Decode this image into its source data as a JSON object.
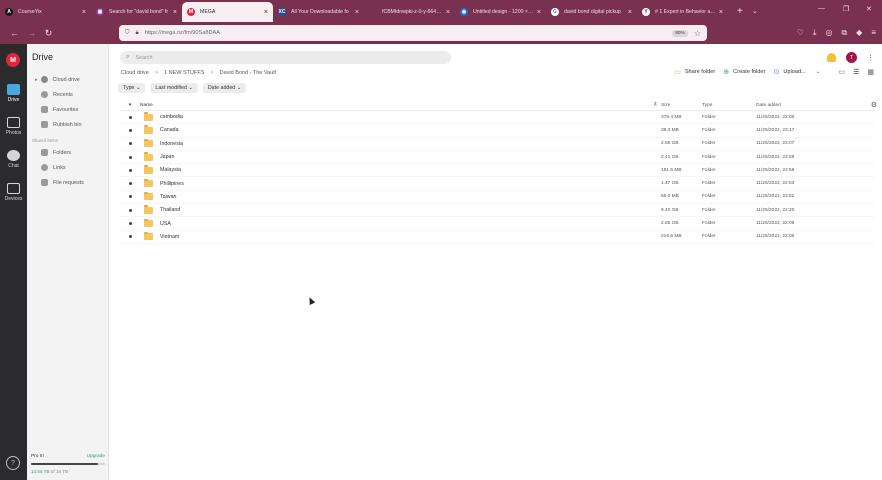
{
  "browser": {
    "tabs": [
      {
        "title": "CourseYix",
        "icon": "A",
        "icon_color": "#1a1a1a",
        "icon_text_color": "#ffffff",
        "active": false
      },
      {
        "title": "Search for \"david bond\" fr",
        "icon": "▣",
        "icon_color": "#8a3a8c",
        "icon_text_color": "#ffffff",
        "active": false
      },
      {
        "title": "MEGA",
        "icon": "M",
        "icon_color": "#e0263a",
        "icon_text_color": "#ffffff",
        "active": true
      },
      {
        "title": "All Your Downloadable fo",
        "icon": "XC",
        "icon_color": "#1a4fa8",
        "icon_text_color": "#ffffff",
        "active": false
      },
      {
        "title": "fCBMtdnwpki-z-0-y-66437acf8",
        "icon": "",
        "icon_color": "#7a3150",
        "icon_text_color": "#ffffff",
        "active": false
      },
      {
        "title": "Untitled design - 1200 × 12",
        "icon": "◉",
        "icon_color": "#1e6fd9",
        "icon_text_color": "#ffffff",
        "active": false
      },
      {
        "title": "david bond digital pickup",
        "icon": "G",
        "icon_color": "#ffffff",
        "icon_text_color": "#4285f4",
        "active": false
      },
      {
        "title": "# 1 Expert in Behavior and",
        "icon": "Y",
        "icon_color": "#ffffff",
        "icon_text_color": "#7a3150",
        "active": false
      }
    ],
    "url": "https://mega.nz/fm/90Sa8DAA",
    "zoom": "80%"
  },
  "rail": {
    "logo": "M",
    "items": [
      {
        "label": "Drive",
        "active": true
      },
      {
        "label": "Photos",
        "active": false
      },
      {
        "label": "Chat",
        "active": false
      },
      {
        "label": "Devices",
        "active": false
      }
    ]
  },
  "sidebar": {
    "title": "Drive",
    "items": [
      {
        "label": "Cloud drive"
      },
      {
        "label": "Recents"
      },
      {
        "label": "Favourites"
      },
      {
        "label": "Rubbish bin"
      }
    ],
    "shared_heading": "Shared items",
    "shared_items": [
      {
        "label": "Folders"
      },
      {
        "label": "Links"
      },
      {
        "label": "File requests"
      }
    ],
    "storage": {
      "plan": "Pro III",
      "upgrade": "Upgrade",
      "used": "14.56 TB",
      "total_text": "of 16 TB",
      "fraction": 0.91
    }
  },
  "main": {
    "search_placeholder": "Search",
    "breadcrumb": [
      "Cloud drive",
      "1 NEW STUFFS",
      "David Bond - The Vault"
    ],
    "breadcrumb_sep": ">",
    "actions": {
      "share": "Share folder",
      "create": "Create folder",
      "upload": "Upload..."
    },
    "filters": [
      "Type",
      "Last modified",
      "Date added"
    ],
    "columns": {
      "name": "Name",
      "size": "Size",
      "type": "Type",
      "date": "Date added"
    },
    "rows": [
      {
        "name": "cambodia",
        "size": "379.4 MB",
        "type": "Folder",
        "date": "11/25/2022, 22:06"
      },
      {
        "name": "Canada",
        "size": "39.3 MB",
        "type": "Folder",
        "date": "11/25/2022, 23:17"
      },
      {
        "name": "Indonesia",
        "size": "2.55 GB",
        "type": "Folder",
        "date": "11/25/2022, 23:07"
      },
      {
        "name": "Japan",
        "size": "2.41 GB",
        "type": "Folder",
        "date": "11/25/2022, 22:59"
      },
      {
        "name": "Malaysia",
        "size": "181.5 MB",
        "type": "Folder",
        "date": "11/25/2022, 22:59"
      },
      {
        "name": "Phillipines",
        "size": "1.47 GB",
        "type": "Folder",
        "date": "11/25/2022, 22:53"
      },
      {
        "name": "Taiwan",
        "size": "65.0 MB",
        "type": "Folder",
        "date": "11/25/2022, 22:52"
      },
      {
        "name": "Thailand",
        "size": "9.40 GB",
        "type": "Folder",
        "date": "11/25/2022, 22:20"
      },
      {
        "name": "USA",
        "size": "2.85 GB",
        "type": "Folder",
        "date": "11/25/2022, 22:08"
      },
      {
        "name": "Vietnam",
        "size": "216.6 MB",
        "type": "Folder",
        "date": "11/25/2022, 22:06"
      }
    ]
  }
}
